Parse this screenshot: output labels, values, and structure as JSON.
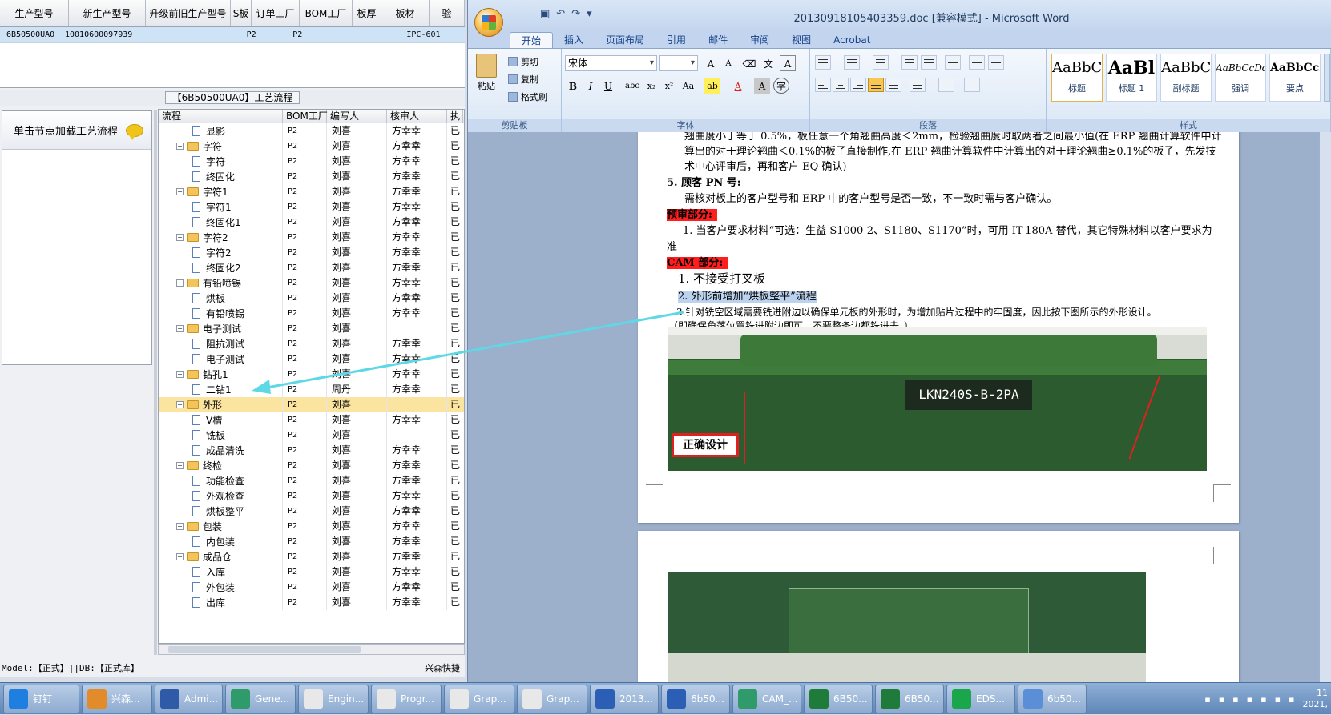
{
  "erp": {
    "grid_headers": [
      "生产型号",
      "新生产型号",
      "升级前旧生产型号",
      "S板",
      "订单工厂",
      "BOM工厂",
      "板厚",
      "板材",
      "验"
    ],
    "grid_row": [
      "6B50500UA0",
      "10010600097939",
      "",
      "",
      "P2",
      "P2",
      "",
      "IPC-601",
      ""
    ],
    "process_title": "【6B50500UA0】工艺流程",
    "load_hint": "单击节点加载工艺流程",
    "tree_headers": [
      "流程",
      "BOM工厂",
      "编写人",
      "核审人",
      "执"
    ],
    "tree_rows": [
      {
        "name": "显影",
        "kind": "doc",
        "f": "P2",
        "w": "刘喜",
        "r": "方幸幸",
        "s": "已"
      },
      {
        "name": "字符",
        "kind": "folder",
        "f": "P2",
        "w": "刘喜",
        "r": "方幸幸",
        "s": "已"
      },
      {
        "name": "字符",
        "kind": "doc",
        "f": "P2",
        "w": "刘喜",
        "r": "方幸幸",
        "s": "已"
      },
      {
        "name": "终固化",
        "kind": "doc",
        "f": "P2",
        "w": "刘喜",
        "r": "方幸幸",
        "s": "已"
      },
      {
        "name": "字符1",
        "kind": "folder",
        "f": "P2",
        "w": "刘喜",
        "r": "方幸幸",
        "s": "已"
      },
      {
        "name": "字符1",
        "kind": "doc",
        "f": "P2",
        "w": "刘喜",
        "r": "方幸幸",
        "s": "已"
      },
      {
        "name": "终固化1",
        "kind": "doc",
        "f": "P2",
        "w": "刘喜",
        "r": "方幸幸",
        "s": "已"
      },
      {
        "name": "字符2",
        "kind": "folder",
        "f": "P2",
        "w": "刘喜",
        "r": "方幸幸",
        "s": "已"
      },
      {
        "name": "字符2",
        "kind": "doc",
        "f": "P2",
        "w": "刘喜",
        "r": "方幸幸",
        "s": "已"
      },
      {
        "name": "终固化2",
        "kind": "doc",
        "f": "P2",
        "w": "刘喜",
        "r": "方幸幸",
        "s": "已"
      },
      {
        "name": "有铅喷锡",
        "kind": "folder",
        "f": "P2",
        "w": "刘喜",
        "r": "方幸幸",
        "s": "已"
      },
      {
        "name": "烘板",
        "kind": "doc",
        "f": "P2",
        "w": "刘喜",
        "r": "方幸幸",
        "s": "已"
      },
      {
        "name": "有铅喷锡",
        "kind": "doc",
        "f": "P2",
        "w": "刘喜",
        "r": "方幸幸",
        "s": "已"
      },
      {
        "name": "电子测试",
        "kind": "folder",
        "f": "P2",
        "w": "刘喜",
        "r": "",
        "s": "已"
      },
      {
        "name": "阻抗测试",
        "kind": "doc",
        "f": "P2",
        "w": "刘喜",
        "r": "方幸幸",
        "s": "已"
      },
      {
        "name": "电子测试",
        "kind": "doc",
        "f": "P2",
        "w": "刘喜",
        "r": "方幸幸",
        "s": "已"
      },
      {
        "name": "钻孔1",
        "kind": "folder",
        "f": "P2",
        "w": "刘喜",
        "r": "方幸幸",
        "s": "已"
      },
      {
        "name": "二钻1",
        "kind": "doc",
        "f": "P2",
        "w": "周丹",
        "r": "方幸幸",
        "s": "已"
      },
      {
        "name": "外形",
        "kind": "folder",
        "f": "P2",
        "w": "刘喜",
        "r": "",
        "s": "已",
        "sel": true
      },
      {
        "name": "V槽",
        "kind": "doc",
        "f": "P2",
        "w": "刘喜",
        "r": "方幸幸",
        "s": "已"
      },
      {
        "name": "铣板",
        "kind": "doc",
        "f": "P2",
        "w": "刘喜",
        "r": "",
        "s": "已"
      },
      {
        "name": "成品清洗",
        "kind": "doc",
        "f": "P2",
        "w": "刘喜",
        "r": "方幸幸",
        "s": "已"
      },
      {
        "name": "终检",
        "kind": "folder",
        "f": "P2",
        "w": "刘喜",
        "r": "方幸幸",
        "s": "已"
      },
      {
        "name": "功能检查",
        "kind": "doc",
        "f": "P2",
        "w": "刘喜",
        "r": "方幸幸",
        "s": "已"
      },
      {
        "name": "外观检查",
        "kind": "doc",
        "f": "P2",
        "w": "刘喜",
        "r": "方幸幸",
        "s": "已"
      },
      {
        "name": "烘板整平",
        "kind": "doc",
        "f": "P2",
        "w": "刘喜",
        "r": "方幸幸",
        "s": "已"
      },
      {
        "name": "包装",
        "kind": "folder",
        "f": "P2",
        "w": "刘喜",
        "r": "方幸幸",
        "s": "已"
      },
      {
        "name": "内包装",
        "kind": "doc",
        "f": "P2",
        "w": "刘喜",
        "r": "方幸幸",
        "s": "已"
      },
      {
        "name": "成品仓",
        "kind": "folder",
        "f": "P2",
        "w": "刘喜",
        "r": "方幸幸",
        "s": "已"
      },
      {
        "name": "入库",
        "kind": "doc",
        "f": "P2",
        "w": "刘喜",
        "r": "方幸幸",
        "s": "已"
      },
      {
        "name": "外包装",
        "kind": "doc",
        "f": "P2",
        "w": "刘喜",
        "r": "方幸幸",
        "s": "已"
      },
      {
        "name": "出库",
        "kind": "doc",
        "f": "P2",
        "w": "刘喜",
        "r": "方幸幸",
        "s": "已"
      }
    ],
    "status_left": "Model:【正式】||DB:【正式库】",
    "status_right": "兴森快捷"
  },
  "word": {
    "title": "20130918105403359.doc [兼容模式] - Microsoft Word",
    "tabs": [
      "开始",
      "插入",
      "页面布局",
      "引用",
      "邮件",
      "审阅",
      "视图",
      "Acrobat"
    ],
    "clipboard": {
      "paste": "粘贴",
      "cut": "剪切",
      "copy": "复制",
      "format_painter": "格式刷",
      "group": "剪贴板"
    },
    "font": {
      "name": "宋体",
      "size": "",
      "group": "字体"
    },
    "paragraph_group": "段落",
    "styles": [
      {
        "preview": "AaBbC",
        "name": "标题"
      },
      {
        "preview": "AaBl",
        "name": "标题 1"
      },
      {
        "preview": "AaBbC",
        "name": "副标题"
      },
      {
        "preview": "AaBbCcDd",
        "name": "强调"
      },
      {
        "preview": "AaBbCcD",
        "name": "要点"
      }
    ],
    "styles_group": "样式",
    "doc_lines": {
      "l1": "翘曲度小于等于 0.5%，板任意一个角翘曲高度＜2mm，检验翘曲度时取两者之间最小值(在 ERP 翘曲计算软件中计",
      "l2": "算出的对于理论翘曲＜0.1%的板子直接制作,在 ERP 翘曲计算软件中计算出的对于理论翘曲≥0.1%的板子，先发技",
      "l3": "术中心评审后，再和客户 EQ 确认)",
      "l4": "5. 顾客 PN 号:",
      "l5": "需核对板上的客户型号和 ERP 中的客户型号是否一致，不一致时需与客户确认。",
      "l6": "预审部分:",
      "l7": "1. 当客户要求材料“可选：生益 S1000-2、S1180、S1170”时，可用 IT-180A 替代，其它特殊材料以客户要求为",
      "l8": "准",
      "l9": "CAM 部分:",
      "l10": "1. 不接受打叉板",
      "l11": "2. 外形前增加“烘板整平”流程",
      "l12": "3.针对铣空区域需要铣进附边以确保单元板的外形时，为增加贴片过程中的牢固度，因此按下图所示的外形设计。",
      "l13": "（即确保角落位置铣进附边即可，不要整条边都铣进去。）"
    },
    "photo_label": "LKN240S-B-2PA",
    "photo_tag": "正确设计"
  },
  "taskbar": {
    "items": [
      {
        "label": "钉钉",
        "color": "#1f7fe0"
      },
      {
        "label": "兴森...",
        "color": "#e28b2b"
      },
      {
        "label": "Admi...",
        "color": "#2e5aa8"
      },
      {
        "label": "Gene...",
        "color": "#2f9a6a"
      },
      {
        "label": "Engin...",
        "color": "#e8e8e8"
      },
      {
        "label": "Progr...",
        "color": "#e8e8e8"
      },
      {
        "label": "Grap...",
        "color": "#e8e8e8"
      },
      {
        "label": "Grap...",
        "color": "#e8e8e8"
      },
      {
        "label": "2013...",
        "color": "#2b5fb5"
      },
      {
        "label": "6b50...",
        "color": "#2b5fb5"
      },
      {
        "label": "CAM_...",
        "color": "#2f9a6a"
      },
      {
        "label": "6B50...",
        "color": "#1e7b3a"
      },
      {
        "label": "6B50...",
        "color": "#1e7b3a"
      },
      {
        "label": "EDS...",
        "color": "#1aa64a"
      },
      {
        "label": "6b50...",
        "color": "#5a8fd8"
      }
    ],
    "clock_time": "11",
    "clock_date": "2021,"
  }
}
